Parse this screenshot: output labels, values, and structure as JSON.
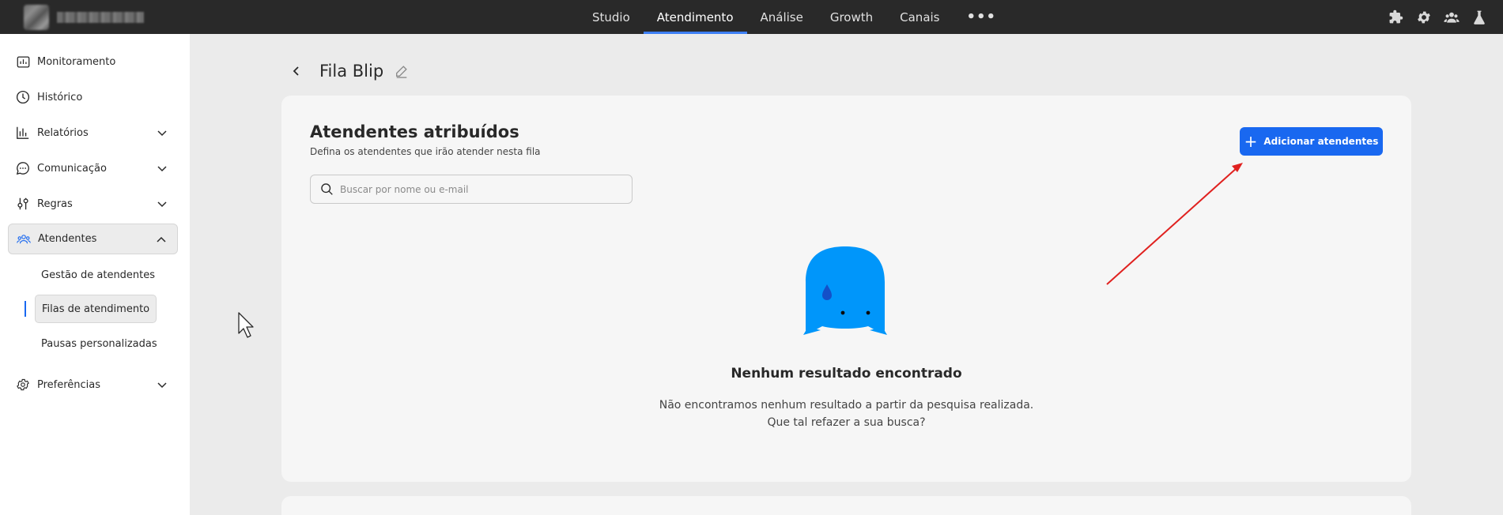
{
  "topbar": {
    "nav": [
      {
        "label": "Studio",
        "active": false
      },
      {
        "label": "Atendimento",
        "active": true
      },
      {
        "label": "Análise",
        "active": false
      },
      {
        "label": "Growth",
        "active": false
      },
      {
        "label": "Canais",
        "active": false
      }
    ],
    "more_label": "•••",
    "right_icons": [
      "puzzle-icon",
      "gear-icon",
      "users-icon",
      "flask-icon"
    ]
  },
  "sidebar": {
    "items": [
      {
        "label": "Monitoramento",
        "icon": "monitor-chart-icon"
      },
      {
        "label": "Histórico",
        "icon": "clock-icon"
      },
      {
        "label": "Relatórios",
        "icon": "bar-chart-icon",
        "expandable": true
      },
      {
        "label": "Comunicação",
        "icon": "chat-bubble-icon",
        "expandable": true
      },
      {
        "label": "Regras",
        "icon": "sliders-icon",
        "expandable": true
      },
      {
        "label": "Atendentes",
        "icon": "users-icon",
        "expandable": true,
        "expanded": true
      },
      {
        "label": "Preferências",
        "icon": "gear-icon",
        "expandable": true
      }
    ],
    "sub_items": [
      {
        "label": "Gestão de atendentes",
        "active": false
      },
      {
        "label": "Filas de atendimento",
        "active": true
      },
      {
        "label": "Pausas personalizadas",
        "active": false
      }
    ]
  },
  "page": {
    "title": "Fila Blip"
  },
  "card": {
    "title": "Atendentes atribuídos",
    "subtitle": "Defina os atendentes que irão atender nesta fila",
    "search_placeholder": "Buscar por nome ou e-mail",
    "search_value": "",
    "add_button_label": "Adicionar atendentes",
    "empty_title": "Nenhum resultado encontrado",
    "empty_line1": "Não encontramos nenhum resultado a partir da pesquisa realizada.",
    "empty_line2": "Que tal refazer a sua busca?"
  },
  "colors": {
    "accent": "#1968f0",
    "topbar": "#292929",
    "annotation_arrow": "#e0211f",
    "illustration": "#0096fa"
  }
}
